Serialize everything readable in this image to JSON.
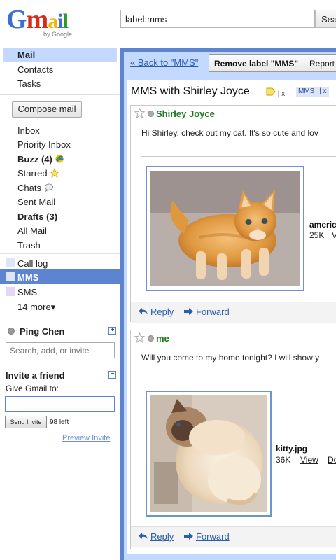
{
  "header": {
    "logo_letters": [
      "G",
      "m",
      "a",
      "i",
      "l"
    ],
    "logo_colors": [
      "#3b6fd6",
      "#d62c1a",
      "#f2b50f",
      "#3b6fd6",
      "#2a9a2f"
    ],
    "logo_sub": "by Google",
    "search_value": "label:mms",
    "search_button": "Sea"
  },
  "sidebar": {
    "mail": "Mail",
    "contacts": "Contacts",
    "tasks": "Tasks",
    "compose": "Compose mail",
    "inbox": "Inbox",
    "priority_inbox": "Priority Inbox",
    "buzz": "Buzz (4)",
    "starred": "Starred",
    "chats": "Chats",
    "sent_mail": "Sent Mail",
    "drafts": "Drafts (3)",
    "all_mail": "All Mail",
    "trash": "Trash",
    "labels": {
      "call_log": "Call log",
      "mms": "MMS",
      "sms": "SMS",
      "more": "14 more▾"
    },
    "label_colors": {
      "call_log": "#dde6f7",
      "mms": "#dde6f7",
      "sms": "#e3d7f5"
    }
  },
  "chat": {
    "user_name": "Ping Chen",
    "search_placeholder": "Search, add, or invite"
  },
  "invite": {
    "title": "Invite a friend",
    "give_label": "Give Gmail to:",
    "send_button": "Send Invite",
    "left_count": "98 left",
    "preview": "Preview Invite"
  },
  "toolbar": {
    "back": "« Back to \"MMS\"",
    "remove_label": "Remove label \"MMS\"",
    "report": "Report"
  },
  "thread": {
    "subject": "MMS with Shirley Joyce",
    "tag_x": "x",
    "tag_mms": "MMS",
    "tag_mms_x": "x"
  },
  "messages": [
    {
      "sender": "Shirley Joyce",
      "body": "Hi Shirley, check out my cat. It's so cute and lov",
      "attachment_name": "americ",
      "attachment_size": "25K",
      "attachment_view": "V",
      "reply": "Reply",
      "forward": "Forward"
    },
    {
      "sender": "me",
      "body": "Will you come to my home tonight? I will show y",
      "attachment_name": "kitty.jpg",
      "attachment_size": "36K",
      "attachment_view": "View",
      "attachment_download": "Do",
      "reply": "Reply",
      "forward": "Forward"
    }
  ]
}
